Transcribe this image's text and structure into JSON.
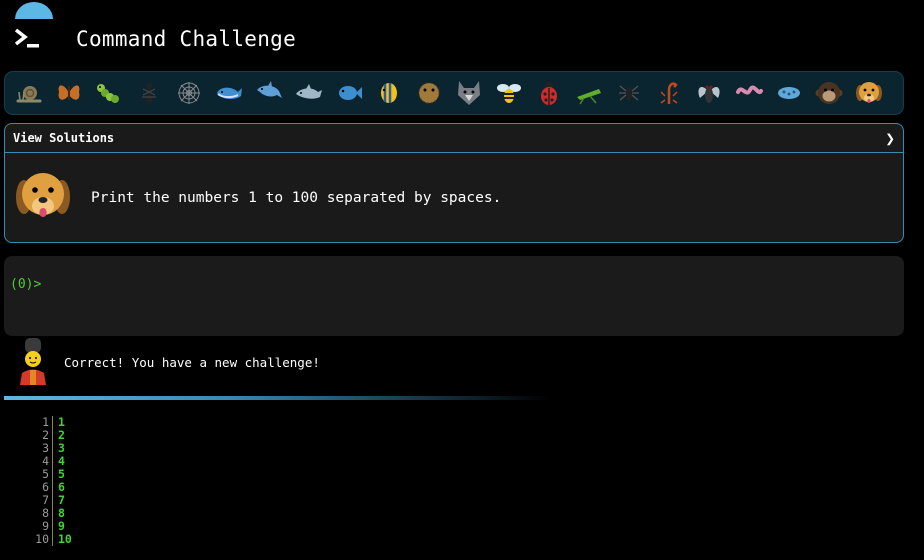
{
  "header": {
    "title": "Command Challenge",
    "icon": "terminal-prompt-icon"
  },
  "animals": [
    "snail",
    "butterfly",
    "caterpillar",
    "ant",
    "spider-web",
    "whale",
    "dolphin",
    "dolphin-2",
    "fish",
    "tropical-fish",
    "pufferfish",
    "wolf",
    "bee",
    "ladybug",
    "cricket",
    "spider",
    "scorpion",
    "fly",
    "worm",
    "microbe",
    "monkey",
    "dog"
  ],
  "challenge": {
    "toggle_label": "View Solutions",
    "toggle_glyph": "❯",
    "text": "Print the numbers 1 to 100 separated by spaces.",
    "avatar": "dog-icon"
  },
  "terminal": {
    "prompt": "(0)>"
  },
  "feedback": {
    "message": "Correct! You have a new challenge!",
    "avatar": "guard-icon"
  },
  "output": {
    "lines": [
      {
        "n": "1",
        "v": "1"
      },
      {
        "n": "2",
        "v": "2"
      },
      {
        "n": "3",
        "v": "3"
      },
      {
        "n": "4",
        "v": "4"
      },
      {
        "n": "5",
        "v": "5"
      },
      {
        "n": "6",
        "v": "6"
      },
      {
        "n": "7",
        "v": "7"
      },
      {
        "n": "8",
        "v": "8"
      },
      {
        "n": "9",
        "v": "9"
      },
      {
        "n": "10",
        "v": "10"
      }
    ]
  },
  "colors": {
    "accent": "#3a8bb4",
    "prompt_green": "#4dcc3a",
    "output_green": "#3fd633"
  }
}
